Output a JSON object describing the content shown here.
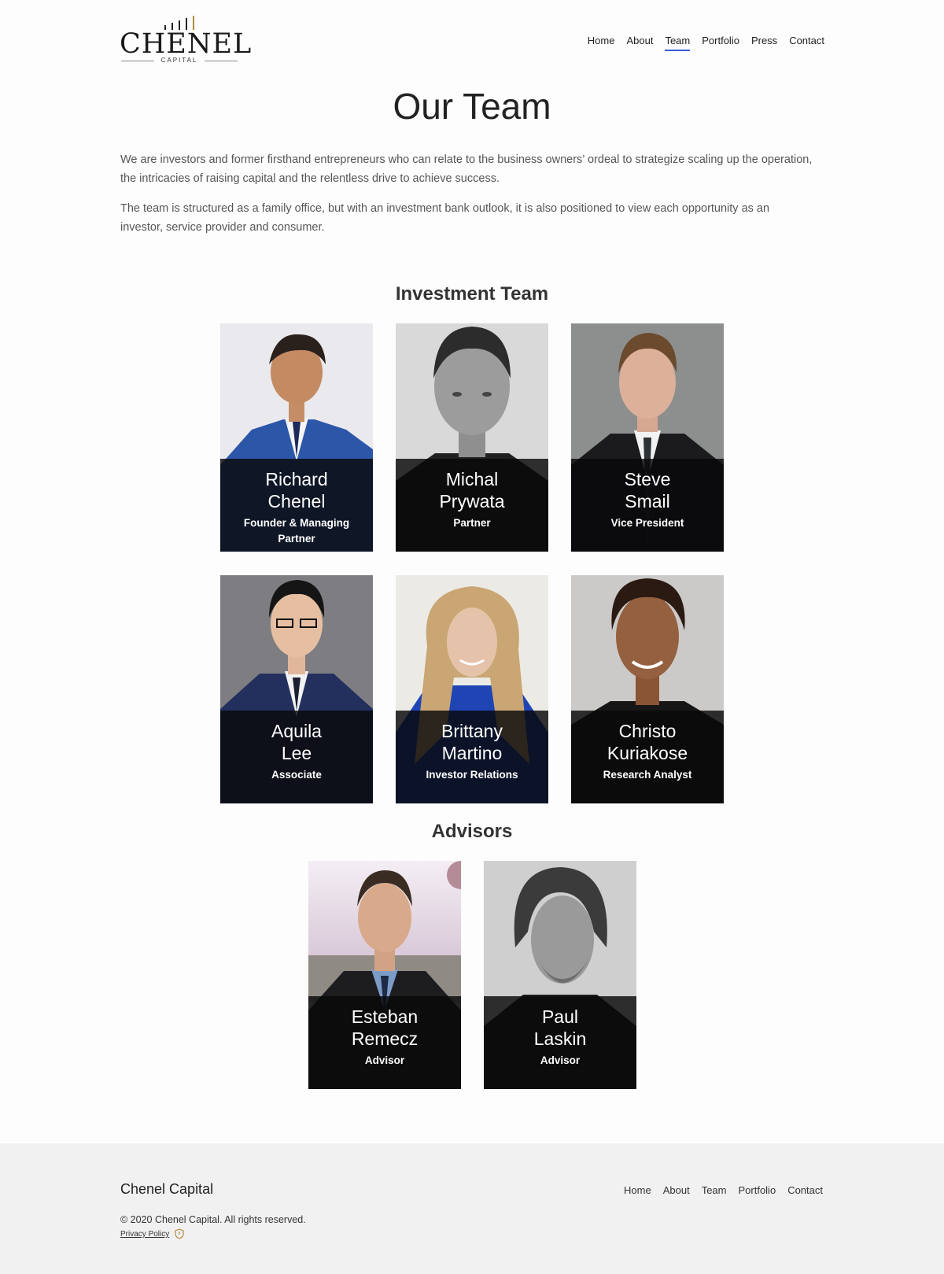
{
  "header": {
    "logo": {
      "name": "CHENEL",
      "sub": "CAPITAL"
    },
    "nav": [
      {
        "label": "Home",
        "active": false
      },
      {
        "label": "About",
        "active": false
      },
      {
        "label": "Team",
        "active": true
      },
      {
        "label": "Portfolio",
        "active": false
      },
      {
        "label": "Press",
        "active": false
      },
      {
        "label": "Contact",
        "active": false
      }
    ],
    "accent_color": "#3c5bd6"
  },
  "hero": {
    "title": "Our Team",
    "paragraphs": [
      "We are investors and former firsthand entrepreneurs who can relate to the business owners’ ordeal to strategize scaling up the operation, the intricacies of raising capital and the relentless drive to achieve success.",
      "The team is structured as a family office, but with an investment bank outlook, it is also positioned to view each opportunity as an investor, service provider and consumer."
    ]
  },
  "investment_team": {
    "heading": "Investment Team",
    "members": [
      {
        "first": "Richard",
        "last": "Chenel",
        "role": "Founder & Managing Partner",
        "photo": "portrait-blue-suit"
      },
      {
        "first": "Michal",
        "last": "Prywata",
        "role": "Partner",
        "photo": "portrait-bw"
      },
      {
        "first": "Steve",
        "last": "Smail",
        "role": "Vice President",
        "photo": "portrait-dark-suit"
      },
      {
        "first": "Aquila",
        "last": "Lee",
        "role": "Associate",
        "photo": "portrait-navy-suit"
      },
      {
        "first": "Brittany",
        "last": "Martino",
        "role": "Investor Relations",
        "photo": "portrait-blonde"
      },
      {
        "first": "Christo",
        "last": "Kuriakose",
        "role": "Research Analyst",
        "photo": "portrait-dark-hair"
      }
    ]
  },
  "advisors": {
    "heading": "Advisors",
    "members": [
      {
        "first": "Esteban",
        "last": "Remecz",
        "role": "Advisor",
        "photo": "portrait-city"
      },
      {
        "first": "Paul",
        "last": "Laskin",
        "role": "Advisor",
        "photo": "portrait-bw-beard"
      }
    ]
  },
  "footer": {
    "brand": "Chenel Capital",
    "nav": [
      "Home",
      "About",
      "Team",
      "Portfolio",
      "Contact"
    ],
    "copyright": "© 2020 Chenel Capital. All rights reserved.",
    "privacy": "Privacy Policy"
  }
}
